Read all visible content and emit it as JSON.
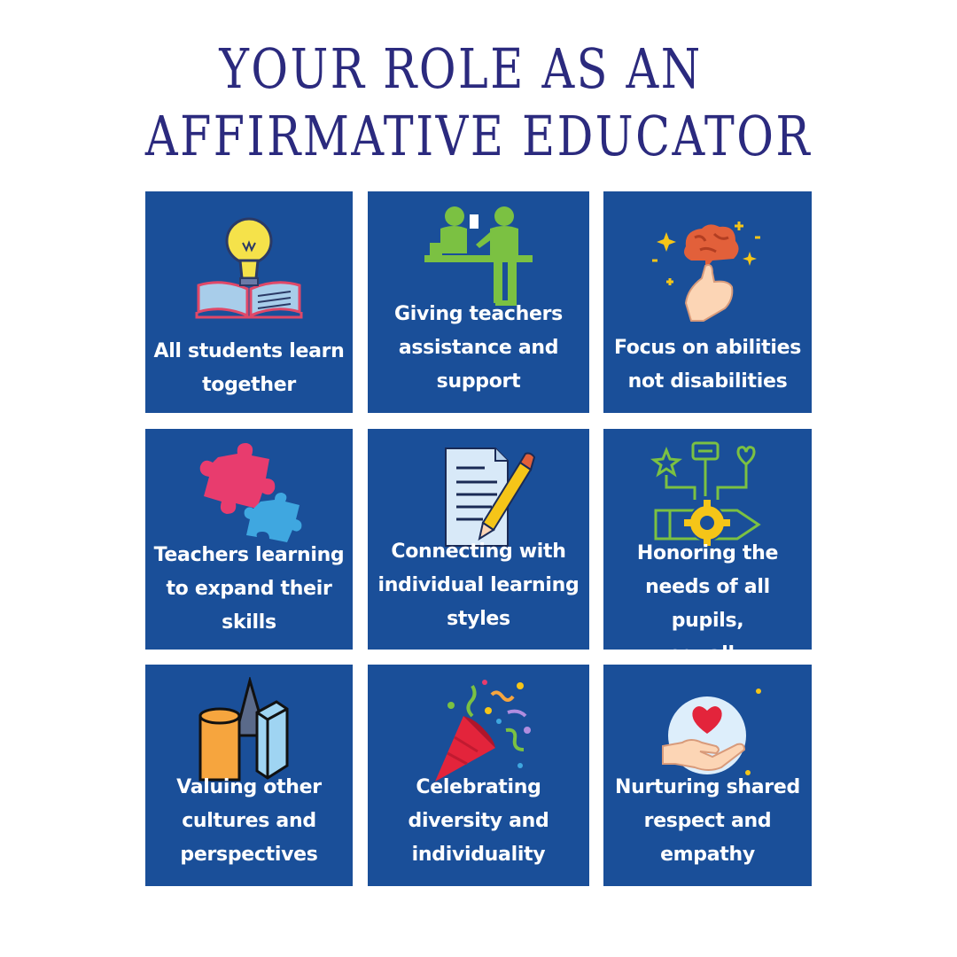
{
  "title": {
    "line1": "YOUR ROLE AS AN",
    "line2": "AFFIRMATIVE EDUCATOR"
  },
  "cards": [
    {
      "lines": [
        "All students learn",
        "together"
      ],
      "icon": "lightbulb-book-icon"
    },
    {
      "lines": [
        "Giving teachers",
        "assistance and",
        "support"
      ],
      "icon": "teachers-meeting-icon"
    },
    {
      "lines": [
        "Focus on abilities",
        "not disabilities"
      ],
      "icon": "brain-hand-icon"
    },
    {
      "lines": [
        "Teachers learning",
        "to expand their",
        "skills"
      ],
      "icon": "puzzle-pieces-icon"
    },
    {
      "lines": [
        "Connecting with",
        "individual learning",
        "styles"
      ],
      "icon": "document-pencil-icon"
    },
    {
      "lines": [
        "Honoring the",
        "needs of all pupils,",
        "equally"
      ],
      "icon": "pencil-gear-icon"
    },
    {
      "lines": [
        "Valuing other",
        "cultures and",
        "perspectives"
      ],
      "icon": "geometric-shapes-icon"
    },
    {
      "lines": [
        "Celebrating",
        "diversity and",
        "individuality"
      ],
      "icon": "party-popper-icon"
    },
    {
      "lines": [
        "Nurturing shared",
        "respect and",
        "empathy"
      ],
      "icon": "heart-hand-icon"
    }
  ],
  "colors": {
    "card_bg": "#1a4f99",
    "title": "#2b2a7e",
    "text": "#ffffff"
  }
}
